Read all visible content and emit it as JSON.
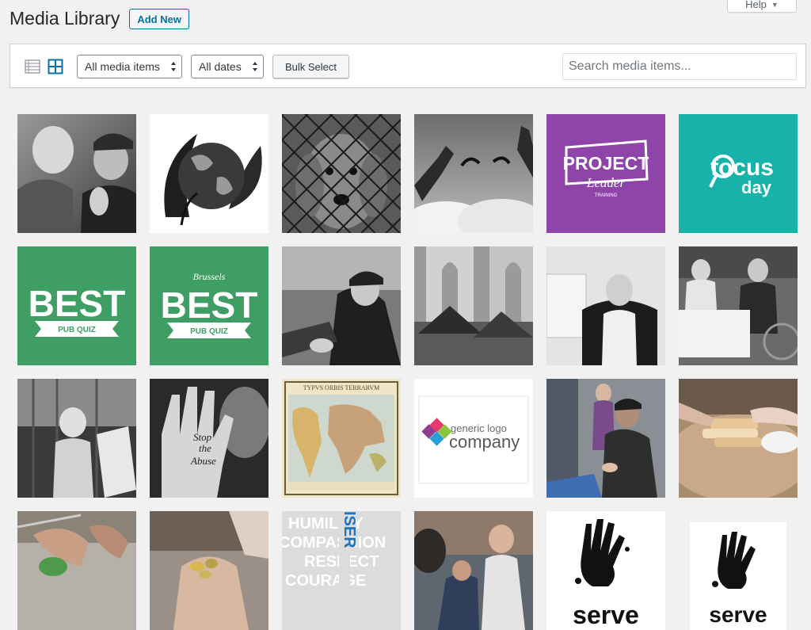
{
  "help": {
    "label": "Help"
  },
  "header": {
    "title": "Media Library",
    "add_new": "Add New"
  },
  "toolbar": {
    "type_filter": "All media items",
    "date_filter": "All dates",
    "bulk_select": "Bulk Select",
    "search_placeholder": "Search media items..."
  },
  "media_texts": {
    "project_top": "PROJECT",
    "project_mid": "Leader",
    "project_small": "TRAINING",
    "focus_a": "focus",
    "focus_b": "day",
    "best": "BEST",
    "pub_quiz": "PUB QUIZ",
    "brussels": "Brussels",
    "stop": "Stop",
    "the": "the",
    "abuse": "Abuse",
    "map_title": "TYPVS ORBIS TERRARVM",
    "generic": "generic logo",
    "company": "company",
    "humility": "HUMILITY",
    "compassion": "COMPASSION",
    "respect": "RESPECT",
    "courage": "COURAGE",
    "serve_vertical": "ISER",
    "serve": "serve"
  },
  "colors": {
    "purple": "#8e44a8",
    "teal": "#17b3aa",
    "green": "#3e9e63",
    "wp_blue": "#0071a1"
  }
}
